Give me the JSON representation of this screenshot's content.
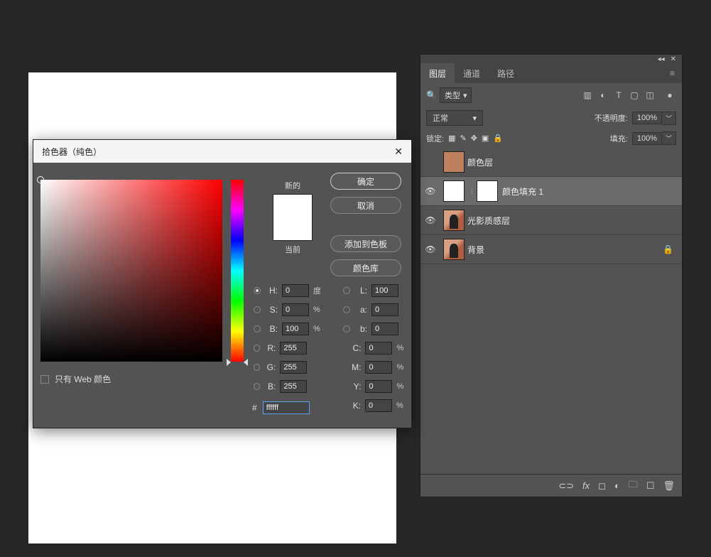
{
  "picker": {
    "title": "拾色器（纯色）",
    "new_label": "新的",
    "current_label": "当前",
    "web_only_label": "只有 Web 颜色",
    "buttons": {
      "ok": "确定",
      "cancel": "取消",
      "add_swatch": "添加到色板",
      "libraries": "颜色库"
    },
    "fields": {
      "H": {
        "value": "0",
        "unit": "度"
      },
      "S": {
        "value": "0",
        "unit": "%"
      },
      "Bv": {
        "value": "100",
        "unit": "%"
      },
      "L": {
        "value": "100"
      },
      "a": {
        "value": "0"
      },
      "b": {
        "value": "0"
      },
      "R": {
        "value": "255"
      },
      "G": {
        "value": "255"
      },
      "Bc": {
        "value": "255"
      },
      "C": {
        "value": "0",
        "unit": "%"
      },
      "M": {
        "value": "0",
        "unit": "%"
      },
      "Y": {
        "value": "0",
        "unit": "%"
      },
      "K": {
        "value": "0",
        "unit": "%"
      },
      "hex": "ffffff"
    },
    "labels": {
      "H": "H:",
      "S": "S:",
      "Bv": "B:",
      "L": "L:",
      "a": "a:",
      "b": "b:",
      "R": "R:",
      "G": "G:",
      "Bc": "B:",
      "C": "C:",
      "M": "M:",
      "Y": "Y:",
      "K": "K:",
      "hash": "#"
    }
  },
  "layers_panel": {
    "tabs": {
      "layers": "图层",
      "channels": "通道",
      "paths": "路径"
    },
    "filter_label": "类型",
    "blend_mode": "正常",
    "opacity_label": "不透明度:",
    "opacity_value": "100%",
    "lock_label": "锁定:",
    "fill_label": "填充:",
    "fill_value": "100%",
    "layers": [
      {
        "name": "颜色层"
      },
      {
        "name": "颜色填充 1"
      },
      {
        "name": "光影质感层"
      },
      {
        "name": "背景"
      }
    ]
  }
}
